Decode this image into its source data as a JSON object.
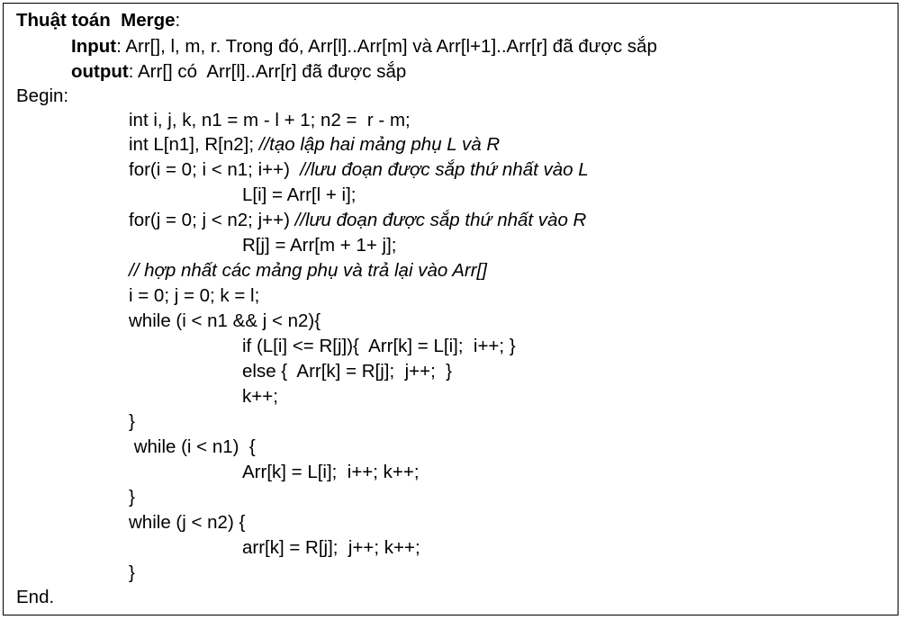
{
  "algorithm": {
    "title_bold": "Thuật toán  Merge",
    "title_colon": ":",
    "input_label": "Input",
    "input_text": ": Arr[], l, m, r. Trong đó, Arr[l]..Arr[m] và Arr[l+1]..Arr[r] đã được sắp",
    "output_label": "output",
    "output_text": ": Arr[] có  Arr[l]..Arr[r] đã được sắp",
    "begin": "Begin:",
    "end": "End."
  },
  "code": {
    "l1": "int i, j, k, n1 = m - l + 1; n2 =  r - m;",
    "l2_code": "int L[n1], R[n2]; ",
    "l2_comment": "//tạo lập hai mảng phụ L và R",
    "l3_code": "for(i = 0; i < n1; i++)  ",
    "l3_comment": "//lưu đoạn được sắp thứ nhất vào L",
    "l4": "L[i] = Arr[l + i];",
    "l5_code": "for(j = 0; j < n2; j++) ",
    "l5_comment": "//lưu đoạn được sắp thứ nhất vào R",
    "l6": "R[j] = Arr[m + 1+ j];",
    "l7_comment": "// hợp nhất các mảng phụ và trả lại vào Arr[]",
    "l8": "i = 0; j = 0; k = l;",
    "l9": "while (i < n1 && j < n2){",
    "l10": "if (L[i] <= R[j]){  Arr[k] = L[i];  i++; }",
    "l11": "else {  Arr[k] = R[j];  j++;  }",
    "l12": "k++;",
    "l13": "}",
    "l14": " while (i < n1)  {",
    "l15": "Arr[k] = L[i];  i++; k++;",
    "l16": "}",
    "l17": "while (j < n2) {",
    "l18": "arr[k] = R[j];  j++; k++;",
    "l19": "}"
  }
}
